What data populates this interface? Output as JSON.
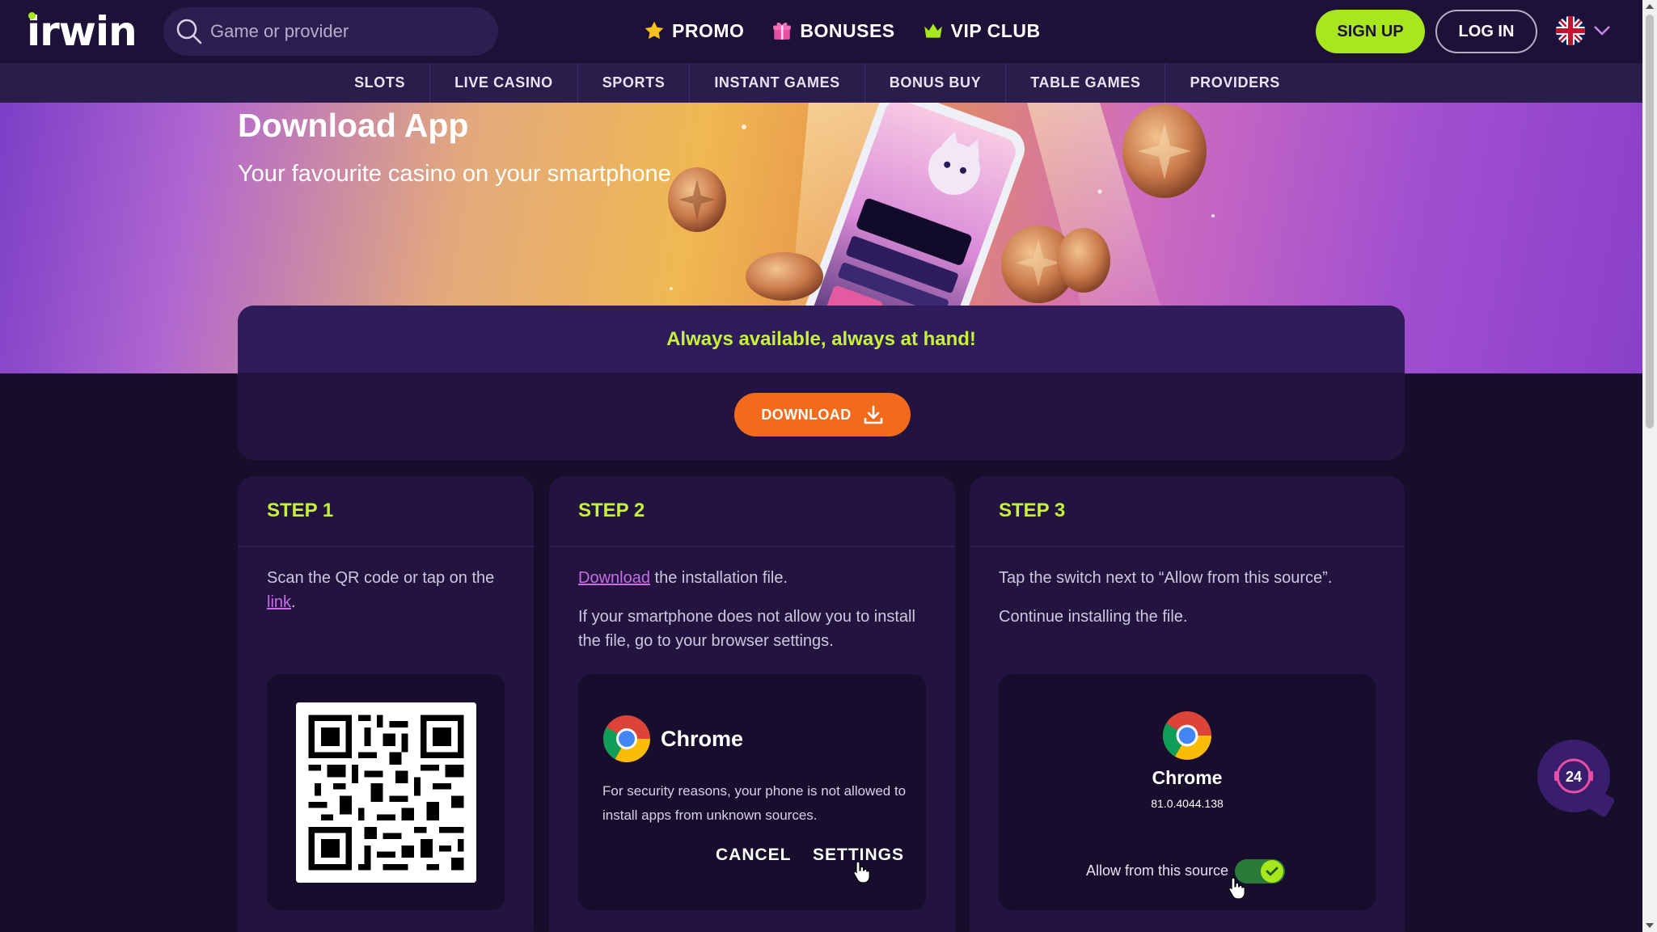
{
  "header": {
    "logo": "irwin",
    "search_placeholder": "Game or provider",
    "nav": [
      {
        "label": "PROMO",
        "icon": "star-icon"
      },
      {
        "label": "BONUSES",
        "icon": "gift-icon"
      },
      {
        "label": "VIP CLUB",
        "icon": "crown-icon"
      }
    ],
    "signup_label": "SIGN UP",
    "login_label": "LOG IN",
    "language_icon": "uk-flag-icon"
  },
  "categories": [
    "SLOTS",
    "LIVE CASINO",
    "SPORTS",
    "INSTANT GAMES",
    "BONUS BUY",
    "TABLE GAMES",
    "PROVIDERS"
  ],
  "hero": {
    "title": "Download App",
    "subtitle": "Your favourite casino on your smartphone"
  },
  "download_panel": {
    "tagline": "Always available, always at hand!",
    "button_label": "DOWNLOAD"
  },
  "steps": [
    {
      "title": "STEP 1",
      "text_before_link": "Scan the QR code or tap on the",
      "link_text": "link",
      "text_after_link": "."
    },
    {
      "title": "STEP 2",
      "link_text": "Download",
      "text_after_link": " the installation file.",
      "text2": "If your smartphone does not allow you to install the file, go to your browser settings.",
      "card": {
        "app_name": "Chrome",
        "message": "For security reasons, your phone is not allowed to install apps from unknown sources.",
        "cancel_label": "CANCEL",
        "settings_label": "SETTINGS"
      }
    },
    {
      "title": "STEP 3",
      "text1": "Tap the switch next to “Allow from this source”.",
      "text2": "Continue installing the file.",
      "card": {
        "app_name": "Chrome",
        "version": "81.0.4044.138",
        "allow_label": "Allow from this source",
        "toggle_on": true
      }
    }
  ],
  "support": {
    "label": "24"
  },
  "colors": {
    "accent_green": "#c7f23a",
    "signup_green": "#a8e61e",
    "download_orange": "#f26a1b",
    "link_purple": "#c86ce8",
    "bg": "#170e2b"
  }
}
